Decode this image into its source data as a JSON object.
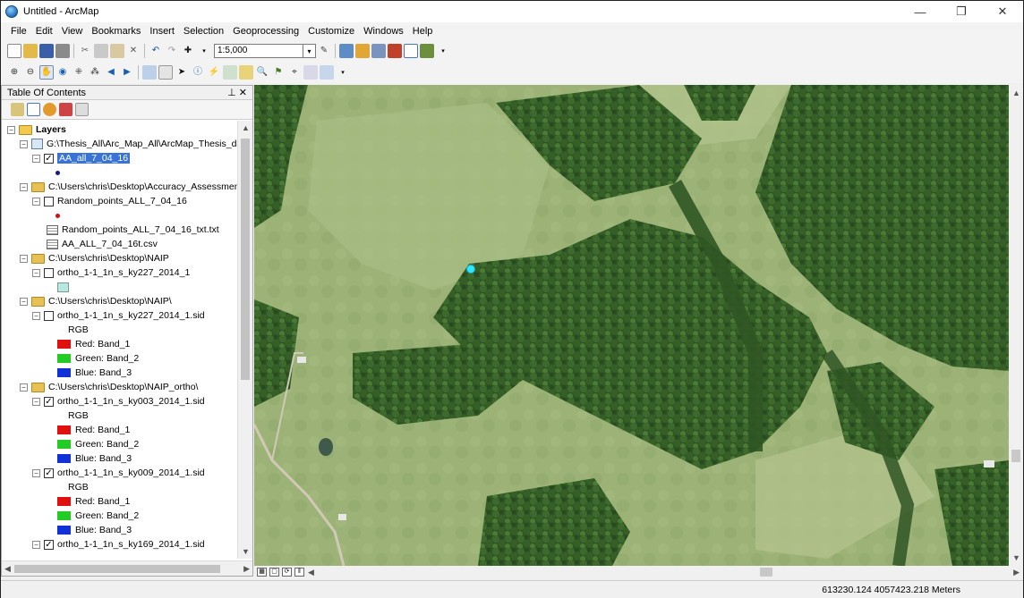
{
  "window": {
    "title": "Untitled - ArcMap",
    "controls": {
      "minimize": "—",
      "restore": "❐",
      "close": "✕"
    }
  },
  "menu": [
    "File",
    "Edit",
    "View",
    "Bookmarks",
    "Insert",
    "Selection",
    "Geoprocessing",
    "Customize",
    "Windows",
    "Help"
  ],
  "toolbar": {
    "scale_value": "1:5,000"
  },
  "toc": {
    "title": "Table Of Contents",
    "pin": "⊥ ✕",
    "layers_label": "Layers",
    "group1": {
      "path": "G:\\Thesis_All\\Arc_Map_All\\ArcMap_Thesis_da",
      "layer": "AA_all_7_04_16"
    },
    "group2": {
      "path": "C:\\Users\\chris\\Desktop\\Accuracy_Assessment",
      "layer": "Random_points_ALL_7_04_16",
      "table1": "Random_points_ALL_7_04_16_txt.txt",
      "table2": "AA_ALL_7_04_16t.csv"
    },
    "group3": {
      "path": "C:\\Users\\chris\\Desktop\\NAIP",
      "layer": "ortho_1-1_1n_s_ky227_2014_1"
    },
    "group4": {
      "path": "C:\\Users\\chris\\Desktop\\NAIP\\",
      "layer": "ortho_1-1_1n_s_ky227_2014_1.sid"
    },
    "group5": {
      "path": "C:\\Users\\chris\\Desktop\\NAIP_ortho\\",
      "layer_a": "ortho_1-1_1n_s_ky003_2014_1.sid",
      "layer_b": "ortho_1-1_1n_s_ky009_2014_1.sid",
      "layer_c": "ortho_1-1_1n_s_ky169_2014_1.sid"
    },
    "rgb": {
      "label": "RGB",
      "red": "Red:  Band_1",
      "green": "Green: Band_2",
      "blue": "Blue:  Band_3"
    }
  },
  "colors": {
    "band_red": "#e01010",
    "band_green": "#22cc22",
    "band_blue": "#1030d8",
    "point_cyan": "#2fe6ff",
    "point_navy": "#1a1a7a",
    "point_red": "#d01010",
    "raster_swatch": "#b8e8e0"
  },
  "status": {
    "coordinates": "613230.124  4057423.218 Meters"
  }
}
